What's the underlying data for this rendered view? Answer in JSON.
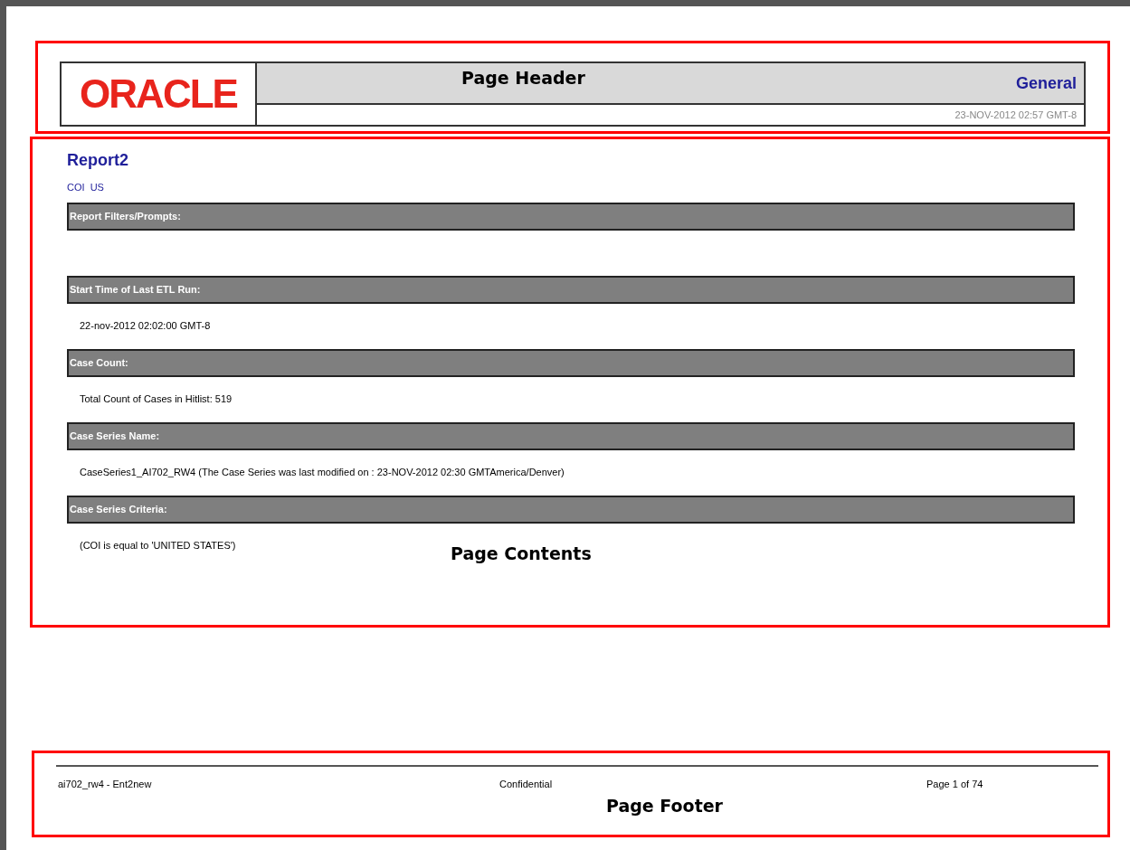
{
  "header": {
    "logo": "ORACLE",
    "annotation": "Page Header",
    "category": "General",
    "timestamp": "23-NOV-2012 02:57 GMT-8"
  },
  "contents": {
    "annotation": "Page Contents",
    "title": "Report2",
    "subtitle": "COI  US",
    "sections": [
      {
        "heading": "Report Filters/Prompts:"
      },
      {
        "heading": "Start Time of Last ETL Run:",
        "value": "22-nov-2012 02:02:00 GMT-8"
      },
      {
        "heading": "Case Count:",
        "value": "Total Count of Cases in Hitlist: 519"
      },
      {
        "heading": "Case Series Name:",
        "value": "CaseSeries1_AI702_RW4 (The Case Series was last modified on : 23-NOV-2012 02:30 GMTAmerica/Denver)"
      },
      {
        "heading": "Case Series Criteria:",
        "value": "(COI is equal to 'UNITED STATES')"
      }
    ]
  },
  "footer": {
    "annotation": "Page Footer",
    "left": "ai702_rw4 - Ent2new",
    "center": "Confidential",
    "right": "Page 1 of 74"
  }
}
